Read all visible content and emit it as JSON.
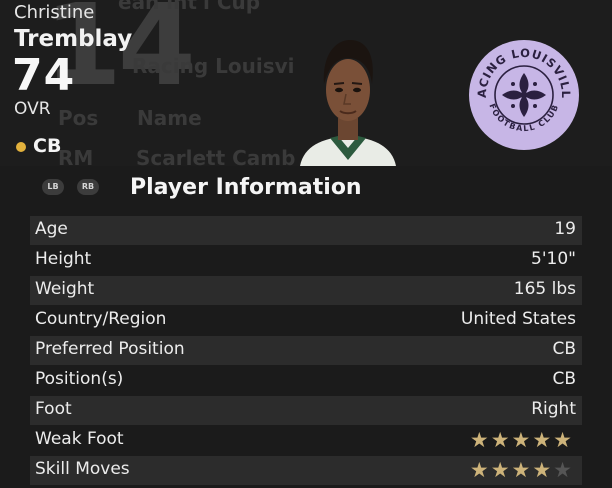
{
  "background_table": {
    "title": "ean int'l Cup",
    "club": "Racing Louisville FC",
    "header_pos": "Pos",
    "header_name": "Name",
    "row_pos": "RM",
    "row_name": "Scarlett Camberos",
    "shirt_number": "14"
  },
  "player": {
    "first_name": "Christine",
    "last_name": "Tremblay",
    "ovr": "74",
    "ovr_label": "OVR",
    "position": "CB",
    "position_color": "#e2b13c"
  },
  "crest": {
    "top_text": "RACING LOUISVILLE",
    "bottom_text": "FOOTBALL CLUB",
    "color": "#c7b6e6"
  },
  "bumpers": {
    "left": "LB",
    "right": "RB"
  },
  "info": {
    "title": "Player Information",
    "rows": [
      {
        "label": "Age",
        "value": "19"
      },
      {
        "label": "Height",
        "value": "5'10\""
      },
      {
        "label": "Weight",
        "value": "165 lbs"
      },
      {
        "label": "Country/Region",
        "value": "United States"
      },
      {
        "label": "Preferred Position",
        "value": "CB"
      },
      {
        "label": "Position(s)",
        "value": "CB"
      },
      {
        "label": "Foot",
        "value": "Right"
      }
    ],
    "weak_foot": {
      "label": "Weak Foot",
      "stars": 5,
      "max": 5
    },
    "skill_moves": {
      "label": "Skill Moves",
      "stars": 4,
      "max": 5
    }
  },
  "colors": {
    "star_on": "#cdb37a",
    "star_off": "#555555"
  }
}
